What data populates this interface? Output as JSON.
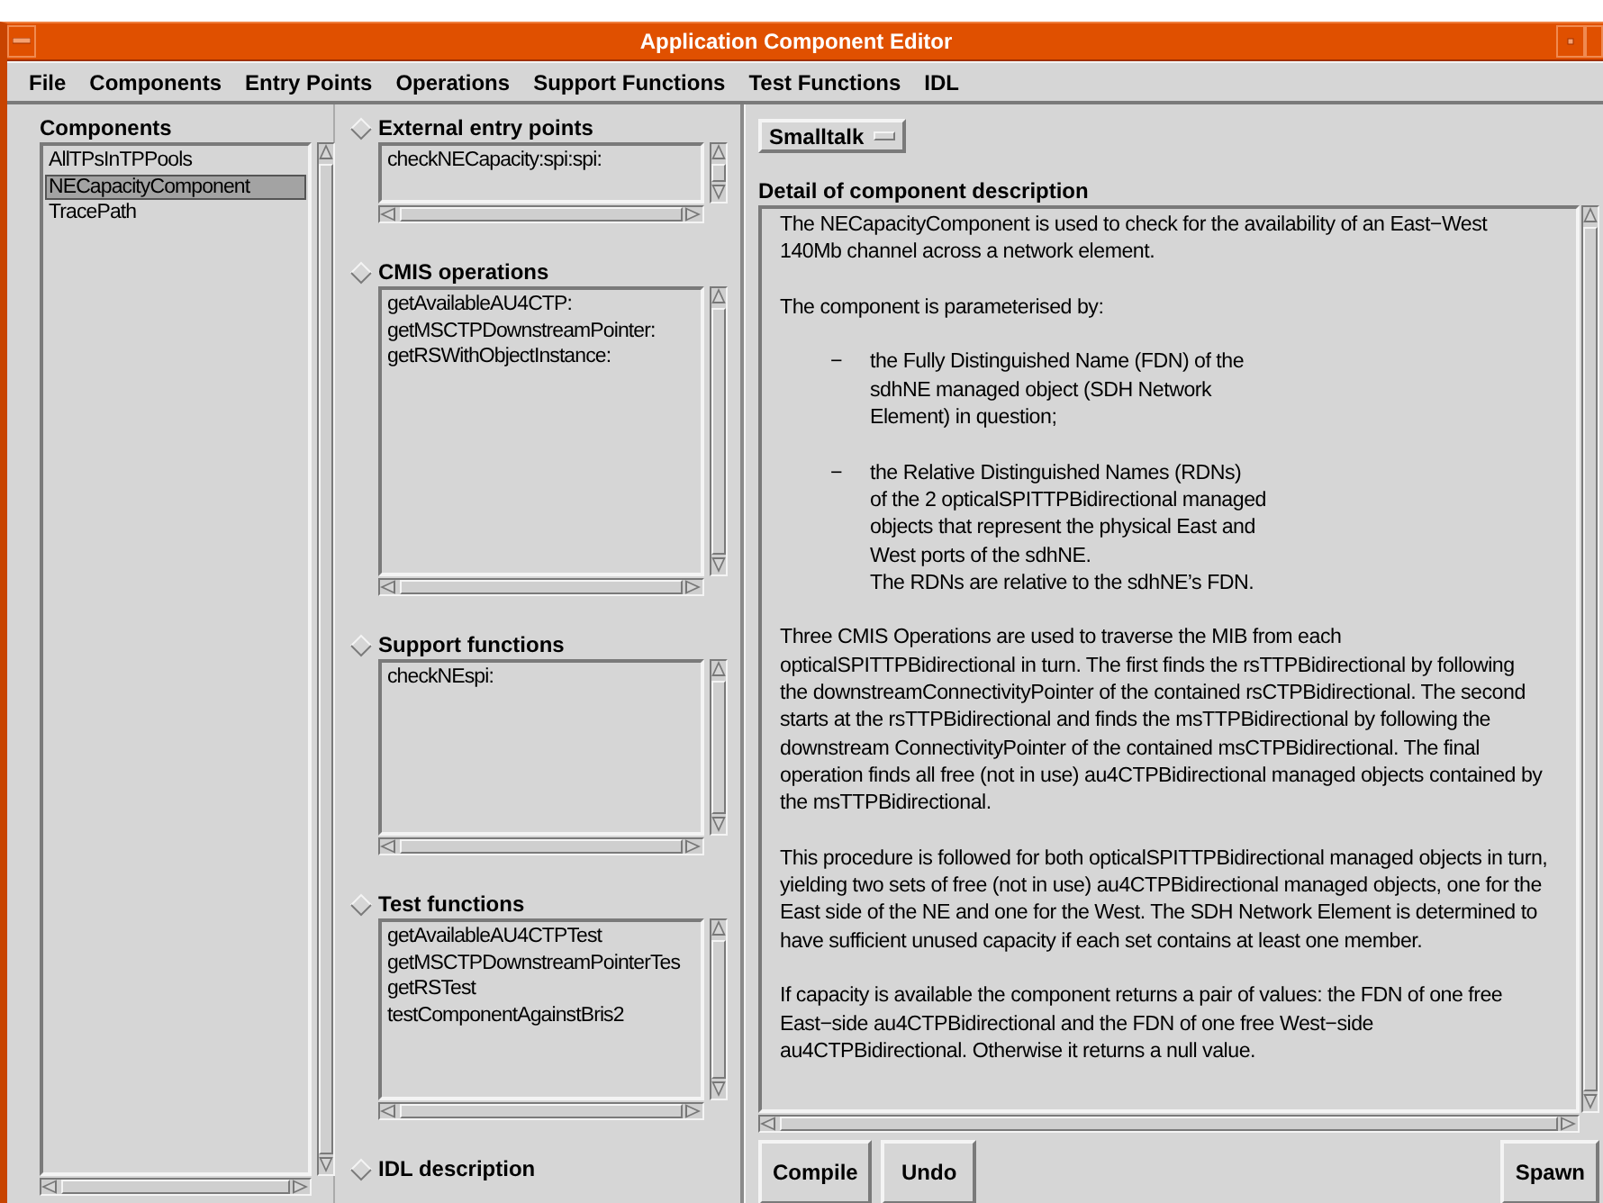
{
  "window": {
    "title": "Application Component Editor"
  },
  "menu": [
    "File",
    "Components",
    "Entry Points",
    "Operations",
    "Support Functions",
    "Test Functions",
    "IDL"
  ],
  "components": {
    "title": "Components",
    "items": [
      {
        "label": "AllTPsInTPPools",
        "selected": false
      },
      {
        "label": "NECapacityComponent",
        "selected": true
      },
      {
        "label": "TracePath",
        "selected": false
      }
    ]
  },
  "sections": [
    {
      "title": "External entry points",
      "items": [
        "checkNECapacity:spi:spi:"
      ]
    },
    {
      "title": "CMIS operations",
      "items": [
        "getAvailableAU4CTP:",
        "getMSCTPDownstreamPointer:",
        "getRSWithObjectInstance:"
      ]
    },
    {
      "title": "Support functions",
      "items": [
        "checkNEspi:"
      ]
    },
    {
      "title": "Test functions",
      "items": [
        "getAvailableAU4CTPTest",
        "getMSCTPDownstreamPointerTes",
        "getRSTest",
        "testComponentAgainstBris2"
      ]
    },
    {
      "title": "IDL description"
    }
  ],
  "language_menu": {
    "value": "Smalltalk"
  },
  "description": {
    "title": "Detail of component description",
    "blocks": [
      {
        "kind": "para",
        "text": "The NECapacityComponent is used to check for the availability of an East−West\n140Mb channel across a network element."
      },
      {
        "kind": "para",
        "text": "The component is parameterised by:"
      },
      {
        "kind": "bullet",
        "marker": "−",
        "text": "the Fully Distinguished Name (FDN) of the\nsdhNE managed object (SDH Network\nElement) in question;"
      },
      {
        "kind": "bullet",
        "marker": "−",
        "text": "the Relative Distinguished Names (RDNs)\nof the 2 opticalSPITTPBidirectional managed\nobjects that represent the physical East and\nWest ports of the sdhNE.\nThe RDNs are relative to the sdhNE’s FDN."
      },
      {
        "kind": "para",
        "text": "Three CMIS Operations are used to traverse the MIB from each\nopticalSPITTPBidirectional in turn. The first finds the rsTTPBidirectional by following\nthe downstreamConnectivityPointer of the contained rsCTPBidirectional. The second\nstarts at the rsTTPBidirectional and finds the msTTPBidirectional by following the\ndownstream ConnectivityPointer of the contained msCTPBidirectional. The final\noperation finds all free (not in use) au4CTPBidirectional managed objects contained by\nthe msTTPBidirectional."
      },
      {
        "kind": "para",
        "text": "This procedure is followed for both opticalSPITTPBidirectional managed objects in turn,\nyielding two sets of free (not in use) au4CTPBidirectional managed objects, one for the\nEast side of the NE and one for the West. The SDH Network Element is determined to\nhave sufficient unused capacity if each set contains at least one member."
      },
      {
        "kind": "para",
        "text": "If capacity is available the component returns a pair of values: the FDN of one free\nEast−side au4CTPBidirectional and the FDN of one free West−side\nau4CTPBidirectional. Otherwise it returns a null value."
      }
    ]
  },
  "buttons_left": [
    "Compile",
    "Undo"
  ],
  "buttons_right": [
    "Spawn"
  ]
}
